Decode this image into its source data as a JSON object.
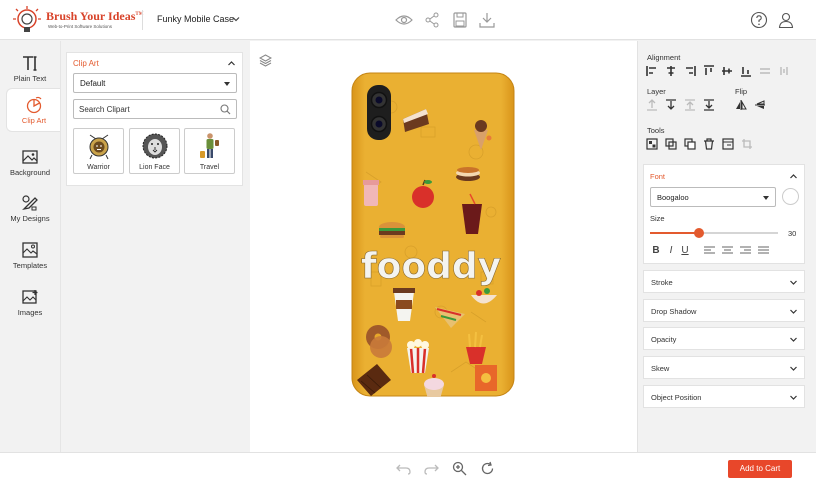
{
  "header": {
    "brand_name": "Brush Your Ideas",
    "brand_tm": "TM",
    "brand_tagline": "Web-to-Print Software Solutions",
    "product_title": "Funky Mobile Case",
    "icons": [
      "eye-icon",
      "share-icon",
      "save-icon",
      "download-icon",
      "help-icon",
      "user-icon"
    ]
  },
  "tools": [
    {
      "label": "Plain Text",
      "icon": "text-icon",
      "active": false
    },
    {
      "label": "Clip Art",
      "icon": "clipart-icon",
      "active": true
    },
    {
      "label": "Background",
      "icon": "background-icon",
      "active": false
    },
    {
      "label": "My Designs",
      "icon": "my-designs-icon",
      "active": false
    },
    {
      "label": "Templates",
      "icon": "templates-icon",
      "active": false
    },
    {
      "label": "Images",
      "icon": "images-icon",
      "active": false
    }
  ],
  "clipart": {
    "title": "Clip Art",
    "category": "Default",
    "search_placeholder": "Search Clipart",
    "items": [
      {
        "label": "Warrior"
      },
      {
        "label": "Lion Face"
      },
      {
        "label": "Travel"
      }
    ]
  },
  "canvas": {
    "design_text": "fooddy",
    "case_color": "#e8a82a"
  },
  "properties": {
    "alignment_label": "Alignment",
    "layer_label": "Layer",
    "flip_label": "Flip",
    "tools_label": "Tools",
    "font": {
      "title": "Font",
      "family": "Boogaloo",
      "size_label": "Size",
      "size_value": "30",
      "size_fraction": 0.38,
      "bold": "B",
      "italic": "I",
      "underline": "U"
    },
    "sections": [
      "Stroke",
      "Drop Shadow",
      "Opacity",
      "Skew",
      "Object Position"
    ]
  },
  "footer": {
    "add_to_cart": "Add to Cart"
  },
  "colors": {
    "accent": "#e35a2e",
    "cart_button": "#e8472a",
    "case": "#e8a82a"
  }
}
